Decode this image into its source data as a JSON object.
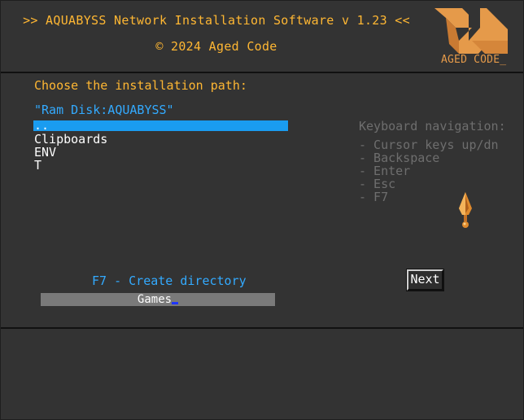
{
  "header": {
    "title_line1": ">> AQUABYSS Network Installation Software v 1.23 <<",
    "title_line2": "© 2024 Aged Code"
  },
  "logo": {
    "text": "AGED CODE_",
    "icon": "aged-code-logo-icon",
    "color": "#e59a4a"
  },
  "main": {
    "prompt": "Choose the installation path:",
    "current_path": "\"Ram Disk:AQUABYSS\"",
    "directories": [
      {
        "label": "..",
        "selected": true
      },
      {
        "label": "Clipboards",
        "selected": false
      },
      {
        "label": "ENV",
        "selected": false
      },
      {
        "label": "T",
        "selected": false
      }
    ],
    "create_hint": "F7 - Create directory",
    "new_dir_value": "Games",
    "next_label": "Next"
  },
  "help": {
    "title": "Keyboard navigation:",
    "items": [
      "- Cursor keys up/dn",
      "- Backspace",
      "- Enter",
      "- Esc",
      "- F7"
    ]
  },
  "decor": {
    "spearhead_icon": "spearhead-icon"
  },
  "colors": {
    "background": "#333333",
    "title": "#ffb733",
    "accent_blue": "#33aaff",
    "selection": "#1a9cf0",
    "help_text": "#6e6e6e"
  }
}
